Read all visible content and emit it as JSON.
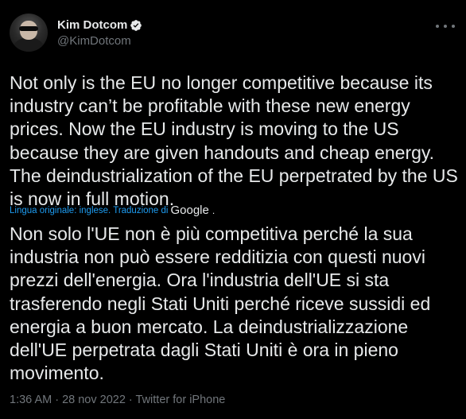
{
  "author": {
    "display_name": "Kim Dotcom",
    "handle": "@KimDotcom",
    "verified": true
  },
  "tweet": {
    "text": "Not only is the EU no longer competitive because its\nindustry can’t be profitable with these new energy\nprices. Now the EU industry is moving to the US\nbecause they are given handouts and cheap energy.\nThe deindustrialization of the EU perpetrated by the US\nis now in full motion.",
    "translation_label": "Lingua originale: inglese. Traduzione di",
    "translation_provider": "Google",
    "translation_suffix": ".",
    "translated_text": "Non solo l'UE non è più competitiva perché la sua\nindustria non può essere redditizia con questi nuovi\nprezzi dell'energia. Ora l'industria dell'UE si sta\ntrasferendo negli Stati Uniti perché riceve sussidi ed\nenergia a buon mercato. La deindustrializzazione\ndell'UE perpetrata dagli Stati Uniti è ora in pieno\nmovimento.",
    "meta": "1:36 AM · 28 nov 2022 · Twitter for iPhone"
  },
  "icons": {
    "verified": "verified-badge-icon",
    "more": "more-options-icon"
  },
  "colors": {
    "background": "#000000",
    "text": "#e7e9ea",
    "secondary": "#71767b",
    "link": "#1d9bf0"
  }
}
